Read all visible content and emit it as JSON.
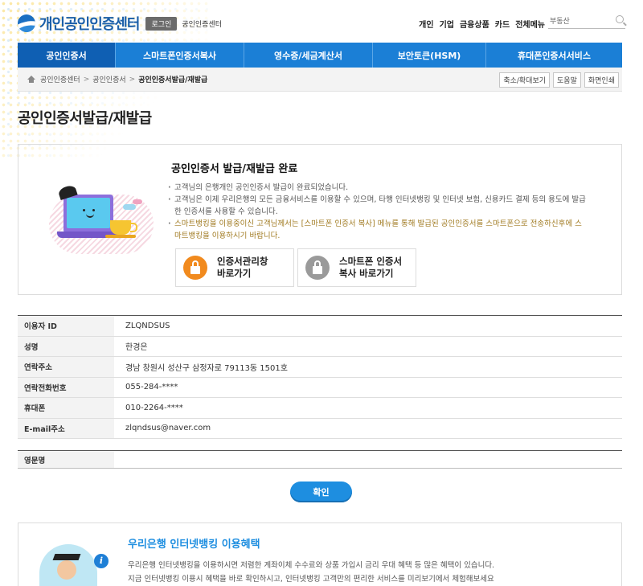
{
  "header": {
    "logo_text": "개인공인인증센터",
    "login_label": "로그인",
    "sub_label": "공인인증센터",
    "top_links": [
      "개인",
      "기업",
      "금융상품",
      "카드",
      "전체메뉴"
    ],
    "search_value": "부동산"
  },
  "nav": {
    "items": [
      {
        "label": "공인인증서"
      },
      {
        "label": "스마트폰인증서복사"
      },
      {
        "label": "영수증/세금계산서"
      },
      {
        "label": "보안토큰(HSM)"
      },
      {
        "label": "휴대폰인증서서비스"
      }
    ]
  },
  "breadcrumb": {
    "items": [
      "공인인증센터",
      "공인인증서",
      "공인인증서발급/재발급"
    ],
    "separator": ">",
    "utils": [
      "축소/확대보기",
      "도움말",
      "화면인쇄"
    ]
  },
  "page_title": "공인인증서발급/재발급",
  "done": {
    "title": "공인인증서 발급/재발급 완료",
    "lines": [
      "고객님의 은행개인 공인인증서 발급이 완료되었습니다.",
      "고객님은 이제 우리은행의 모든 금융서비스를 이용할 수 있으며, 타행 인터넷뱅킹 및 인터넷 보험, 신용카드 결제 등의 용도에 발급한 인증서를 사용할 수 있습니다.",
      "스마트뱅킹을 이용중이신 고객님께서는 [스마트폰 인증서 복사] 메뉴를 통해 발급된 공인인증서를 스마트폰으로 전송하신후에 스마트뱅킹을 이용하시기 바랍니다."
    ],
    "btn_manage": "인증서관리창\n바로가기",
    "btn_copy": "스마트폰 인증서\n복사 바로가기"
  },
  "info": {
    "rows": [
      {
        "label": "이용자 ID",
        "value": "ZLQNDSUS"
      },
      {
        "label": "성명",
        "value": "한경은"
      },
      {
        "label": "연락주소",
        "value": "경남 창원시 성산구 삼정자로 79113동 1501호"
      },
      {
        "label": "연락전화번호",
        "value": "055-284-****"
      },
      {
        "label": "휴대폰",
        "value": "010-2264-****"
      },
      {
        "label": "E-mail주소",
        "value": "zlqndsus@naver.com"
      }
    ],
    "eng_label": "영문명",
    "eng_value": ""
  },
  "confirm_label": "확인",
  "benefit": {
    "title": "우리은행 인터넷뱅킹 이용혜택",
    "line1": "우리은행 인터넷뱅킹을 이용하시면 저렴한 계좌이체 수수료와 상품 가입시 금리 우대 혜택 등 많은 혜택이 있습니다.",
    "line2": "지금 인터넷뱅킹 이용시 혜택을 바로 확인하시고, 인터넷뱅킹 고객만의 편리한 서비스를 미리보기에서 체험해보세요",
    "info_glyph": "i"
  },
  "colors": {
    "nav": "#1b7fd6",
    "nav_active": "#0f5fb3",
    "accent": "#1e8ee0",
    "highlight_text": "#a07a20"
  }
}
